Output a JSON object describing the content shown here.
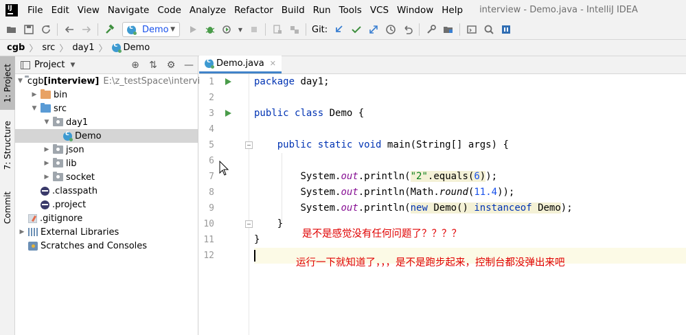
{
  "window": {
    "title": "interview - Demo.java - IntelliJ IDEA"
  },
  "menu": [
    "File",
    "Edit",
    "View",
    "Navigate",
    "Code",
    "Analyze",
    "Refactor",
    "Build",
    "Run",
    "Tools",
    "VCS",
    "Window",
    "Help"
  ],
  "toolbar": {
    "run_config": "Demo",
    "git_label": "Git:"
  },
  "breadcrumb": [
    "cgb",
    "src",
    "day1",
    "Demo"
  ],
  "side_tabs": [
    "1: Project",
    "7: Structure",
    "Commit"
  ],
  "project_panel": {
    "title": "Project",
    "tree": [
      {
        "label": "cgb",
        "bold": "[interview]",
        "path": "E:\\z_testSpace\\intervie",
        "indent": 0,
        "arrow": "▼",
        "icon": "module"
      },
      {
        "label": "bin",
        "indent": 1,
        "arrow": "▶",
        "icon": "folder-orange"
      },
      {
        "label": "src",
        "indent": 1,
        "arrow": "▼",
        "icon": "folder-blue"
      },
      {
        "label": "day1",
        "indent": 2,
        "arrow": "▼",
        "icon": "package"
      },
      {
        "label": "Demo",
        "indent": 3,
        "arrow": "",
        "icon": "class",
        "selected": true
      },
      {
        "label": "json",
        "indent": 2,
        "arrow": "▶",
        "icon": "package"
      },
      {
        "label": "lib",
        "indent": 2,
        "arrow": "▶",
        "icon": "package"
      },
      {
        "label": "socket",
        "indent": 2,
        "arrow": "▶",
        "icon": "package"
      },
      {
        "label": ".classpath",
        "indent": 1,
        "arrow": "",
        "icon": "eclipse"
      },
      {
        "label": ".project",
        "indent": 1,
        "arrow": "",
        "icon": "eclipse"
      },
      {
        "label": ".gitignore",
        "indent": 0,
        "arrow": "",
        "icon": "gitignore"
      },
      {
        "label": "External Libraries",
        "indent": 0,
        "arrow": "▶",
        "icon": "libraries"
      },
      {
        "label": "Scratches and Consoles",
        "indent": 0,
        "arrow": "",
        "icon": "scratches"
      }
    ]
  },
  "editor": {
    "tab": "Demo.java",
    "line_numbers": [
      "1",
      "2",
      "3",
      "4",
      "5",
      "6",
      "7",
      "8",
      "9",
      "10",
      "11",
      "12"
    ],
    "code": {
      "l1": {
        "kw": "package",
        "rest": " day1;"
      },
      "l3": {
        "kw1": "public",
        "kw2": "class",
        "rest": " Demo {"
      },
      "l5": {
        "kw1": "public",
        "kw2": "static",
        "kw3": "void",
        "rest": " main(String[] args) {"
      },
      "l7": {
        "a": "System.",
        "f": "out",
        "b": ".println(",
        "s": "\"2\"",
        "c": ".equals(",
        "n": "6",
        "d": "));"
      },
      "l8": {
        "a": "System.",
        "f": "out",
        "b": ".println(Math.",
        "i": "round",
        "c": "(",
        "n": "11.4",
        "d": "));"
      },
      "l9": {
        "a": "System.",
        "f": "out",
        "b": ".println(",
        "k1": "new",
        "c": " Demo() ",
        "k2": "instanceof",
        "d": " Demo",
        ",e": ");"
      },
      "l10": {
        "rest": "}"
      },
      "l11": {
        "rest": "}"
      }
    }
  },
  "annotations": {
    "note1": "是不是感觉没有任何问题了？？？？",
    "note2": "运行一下就知道了，，，是不是跑步起来，控制台都没弹出来吧"
  }
}
